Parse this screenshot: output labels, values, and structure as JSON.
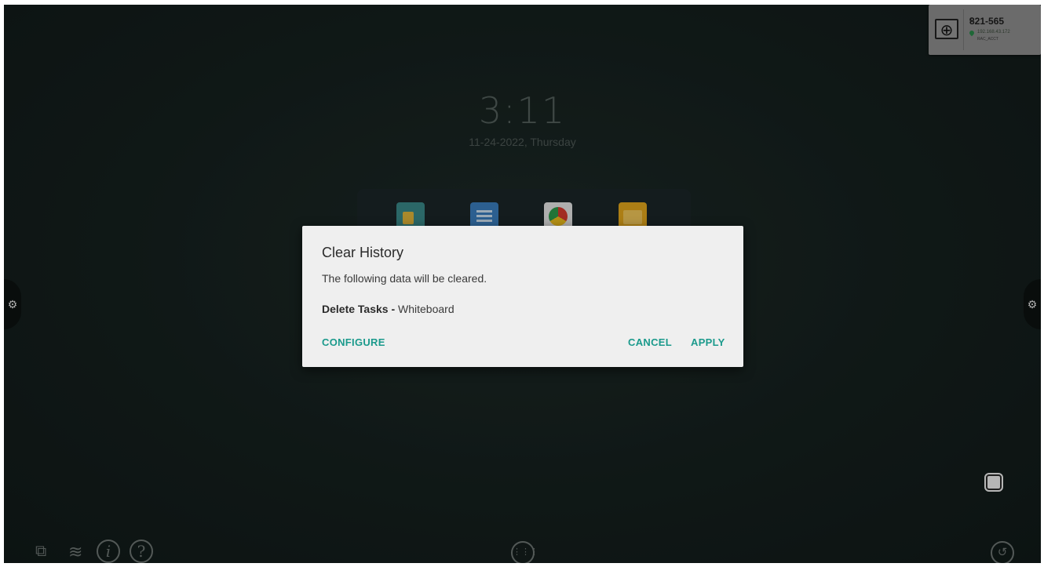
{
  "lockscreen": {
    "time": "3:11",
    "date": "11-24-2022, Thursday"
  },
  "dock": {
    "apps": [
      "presentation-app-icon",
      "whiteboard-app-icon",
      "chrome-app-icon",
      "file-manager-app-icon"
    ]
  },
  "badge": {
    "code": "821-565",
    "ip": "192.168.43.172",
    "network": "RAC_ACCT",
    "icon": "screen-share-icon"
  },
  "dialog": {
    "title": "Clear History",
    "message": "The following data will be cleared.",
    "item_bold": "Delete Tasks -",
    "item_rest": " Whiteboard",
    "configure": "CONFIGURE",
    "cancel": "CANCEL",
    "apply": "APPLY",
    "accent_color": "#1b9a8c"
  },
  "bottom_bar": {
    "icons": [
      "network-icon",
      "wifi-icon",
      "info-icon",
      "help-icon",
      "apps-icon",
      "history-icon"
    ]
  }
}
